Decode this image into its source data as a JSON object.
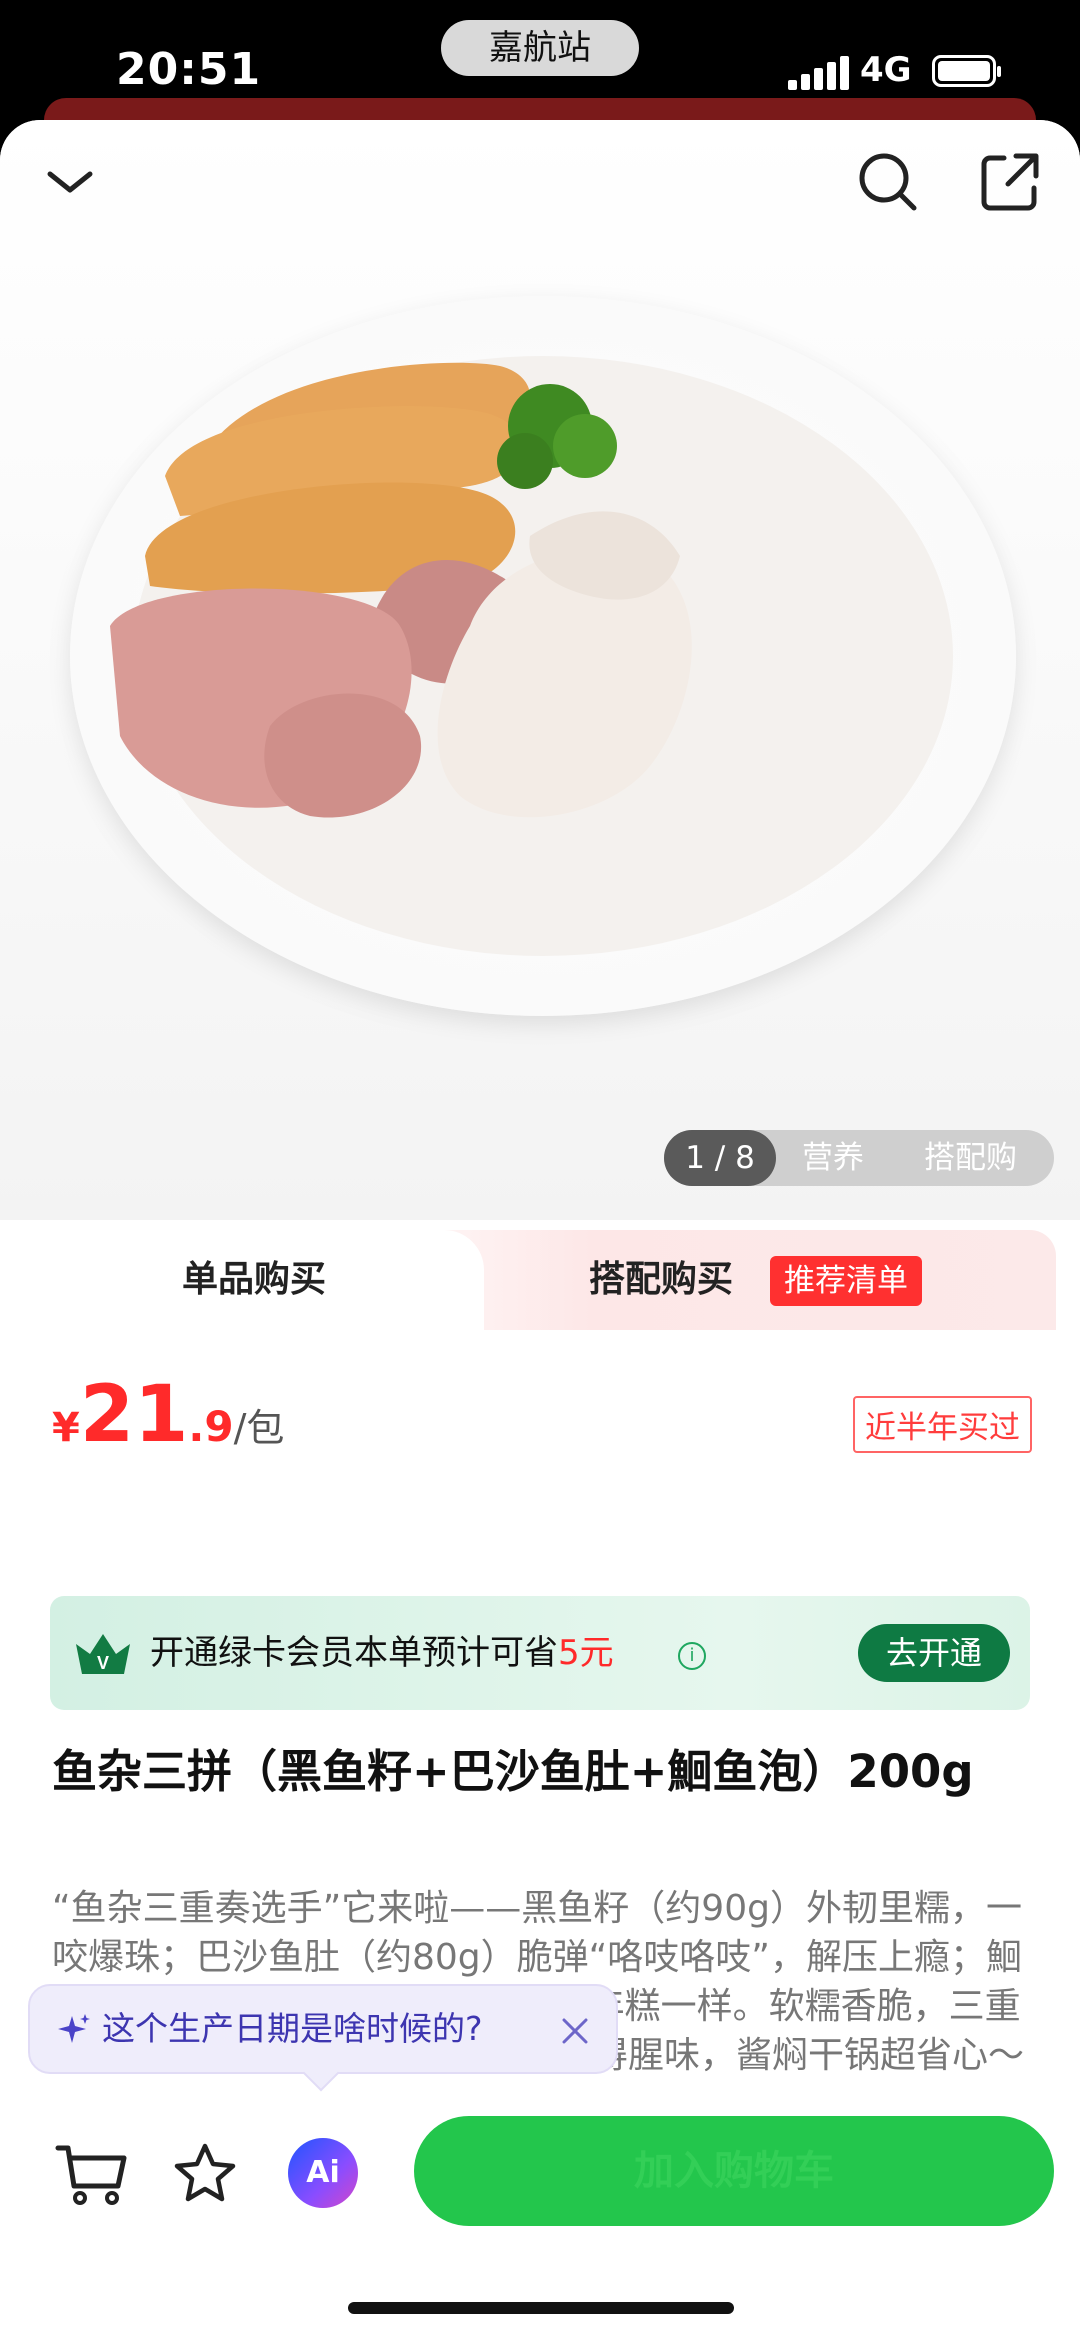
{
  "status_bar": {
    "time": "20:51",
    "island_label": "嘉航站",
    "network": "4G"
  },
  "header": {
    "icons": [
      "chevron-down-icon",
      "search-icon",
      "share-icon"
    ]
  },
  "gallery": {
    "pager": "1 / 8",
    "tabs": [
      "营养",
      "搭配购"
    ]
  },
  "purchase": {
    "tab_single": "单品购买",
    "tab_combo": "搭配购买",
    "tab_combo_tag": "推荐清单",
    "price": {
      "currency": "¥",
      "integer": "21",
      "decimal": ".9",
      "unit": "/包"
    },
    "bought_badge": "近半年买过",
    "member": {
      "text_before": "开通绿卡会员本单预计可省",
      "amount": "5元",
      "button": "去开通"
    },
    "title": "鱼杂三拼（黑鱼籽+巴沙鱼肚+鮰鱼泡）200g",
    "description": "“鱼杂三重奏选手”它来啦——黑鱼籽（约90g）外韧里糯，一咬爆珠；巴沙鱼肚（约80g）脆弹“咯吱咯吱”，解压上瘾；鮰鱼泡（约30g）软糯吸汁，焖完像年糕一样。软糯香脆，三重口感层层递进！活鱼鲜杀直取，没得腥味，酱焖干锅超省心～"
  },
  "ai_bubble": {
    "text": "这个生产日期是啥时候的?"
  },
  "bottom_bar": {
    "cta_label": "加入购物车"
  },
  "colors": {
    "price_red": "#ff2a2a",
    "member_green": "#0e7a43",
    "cta_green": "#23c64c",
    "ai_purple": "#3d35b0"
  }
}
